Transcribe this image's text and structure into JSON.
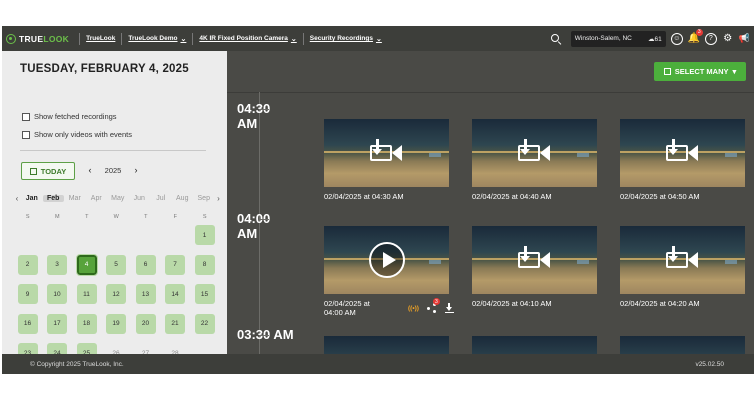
{
  "header": {
    "logo": {
      "true": "TRUE",
      "look": "LOOK"
    },
    "breadcrumbs": [
      {
        "label": "TrueLook",
        "chevron": false
      },
      {
        "label": "TrueLook Demo",
        "chevron": true
      },
      {
        "label": "4K IR Fixed Position Camera",
        "chevron": true
      },
      {
        "label": "Security Recordings",
        "chevron": true
      }
    ],
    "location": "Winston-Salem, NC",
    "temperature": "61",
    "notification_count": "3"
  },
  "sidebar": {
    "date_title": "TUESDAY, FEBRUARY 4, 2025",
    "checkboxes": [
      {
        "label": "Show fetched recordings",
        "checked": false
      },
      {
        "label": "Show only videos with events",
        "checked": false
      }
    ],
    "today_label": "TODAY",
    "year": "2025",
    "months": [
      "Jan",
      "Feb",
      "Mar",
      "Apr",
      "May",
      "Jun",
      "Jul",
      "Aug",
      "Sep"
    ],
    "active_months": [
      "Jan",
      "Feb"
    ],
    "selected_month": "Feb",
    "weekdays": [
      "S",
      "M",
      "T",
      "W",
      "T",
      "F",
      "S"
    ],
    "days": [
      {
        "d": "1",
        "ev": true
      },
      {
        "d": "2",
        "ev": true
      },
      {
        "d": "3",
        "ev": true
      },
      {
        "d": "4",
        "ev": true,
        "sel": true
      },
      {
        "d": "5",
        "ev": true
      },
      {
        "d": "6",
        "ev": true
      },
      {
        "d": "7",
        "ev": true
      },
      {
        "d": "8",
        "ev": true
      },
      {
        "d": "9",
        "ev": true
      },
      {
        "d": "10",
        "ev": true
      },
      {
        "d": "11",
        "ev": true
      },
      {
        "d": "12",
        "ev": true
      },
      {
        "d": "13",
        "ev": true
      },
      {
        "d": "14",
        "ev": true
      },
      {
        "d": "15",
        "ev": true
      },
      {
        "d": "16",
        "ev": true
      },
      {
        "d": "17",
        "ev": true
      },
      {
        "d": "18",
        "ev": true
      },
      {
        "d": "19",
        "ev": true
      },
      {
        "d": "20",
        "ev": true
      },
      {
        "d": "21",
        "ev": true
      },
      {
        "d": "22",
        "ev": true
      },
      {
        "d": "23",
        "ev": true
      },
      {
        "d": "24",
        "ev": true
      },
      {
        "d": "25",
        "ev": true
      },
      {
        "d": "26",
        "ev": false
      },
      {
        "d": "27",
        "ev": false
      },
      {
        "d": "28",
        "ev": false
      }
    ],
    "first_weekday_index": 6
  },
  "main": {
    "select_many_label": "SELECT MANY",
    "groups": [
      {
        "time": "04:30\nAM",
        "items": [
          {
            "caption": "02/04/2025 at 04:30 AM"
          },
          {
            "caption": "02/04/2025 at 04:40 AM"
          },
          {
            "caption": "02/04/2025 at 04:50 AM"
          }
        ]
      },
      {
        "time": "04:00\nAM",
        "items": [
          {
            "caption": "02/04/2025 at\n04:00 AM",
            "playing": true
          },
          {
            "caption": "02/04/2025 at 04:10 AM"
          },
          {
            "caption": "02/04/2025 at 04:20 AM"
          }
        ]
      },
      {
        "time": "03:30 AM",
        "items": [
          {
            "caption": ""
          },
          {
            "caption": ""
          },
          {
            "caption": ""
          }
        ]
      }
    ],
    "share_badge": "3",
    "wave_label": "((•))"
  },
  "footer": {
    "copyright": "© Copyright 2025 TrueLook, Inc.",
    "version": "v25.02.50"
  },
  "colors": {
    "accent": "#4caf3c",
    "brand": "#6cc04a",
    "day_event": "#b9d9a8"
  }
}
